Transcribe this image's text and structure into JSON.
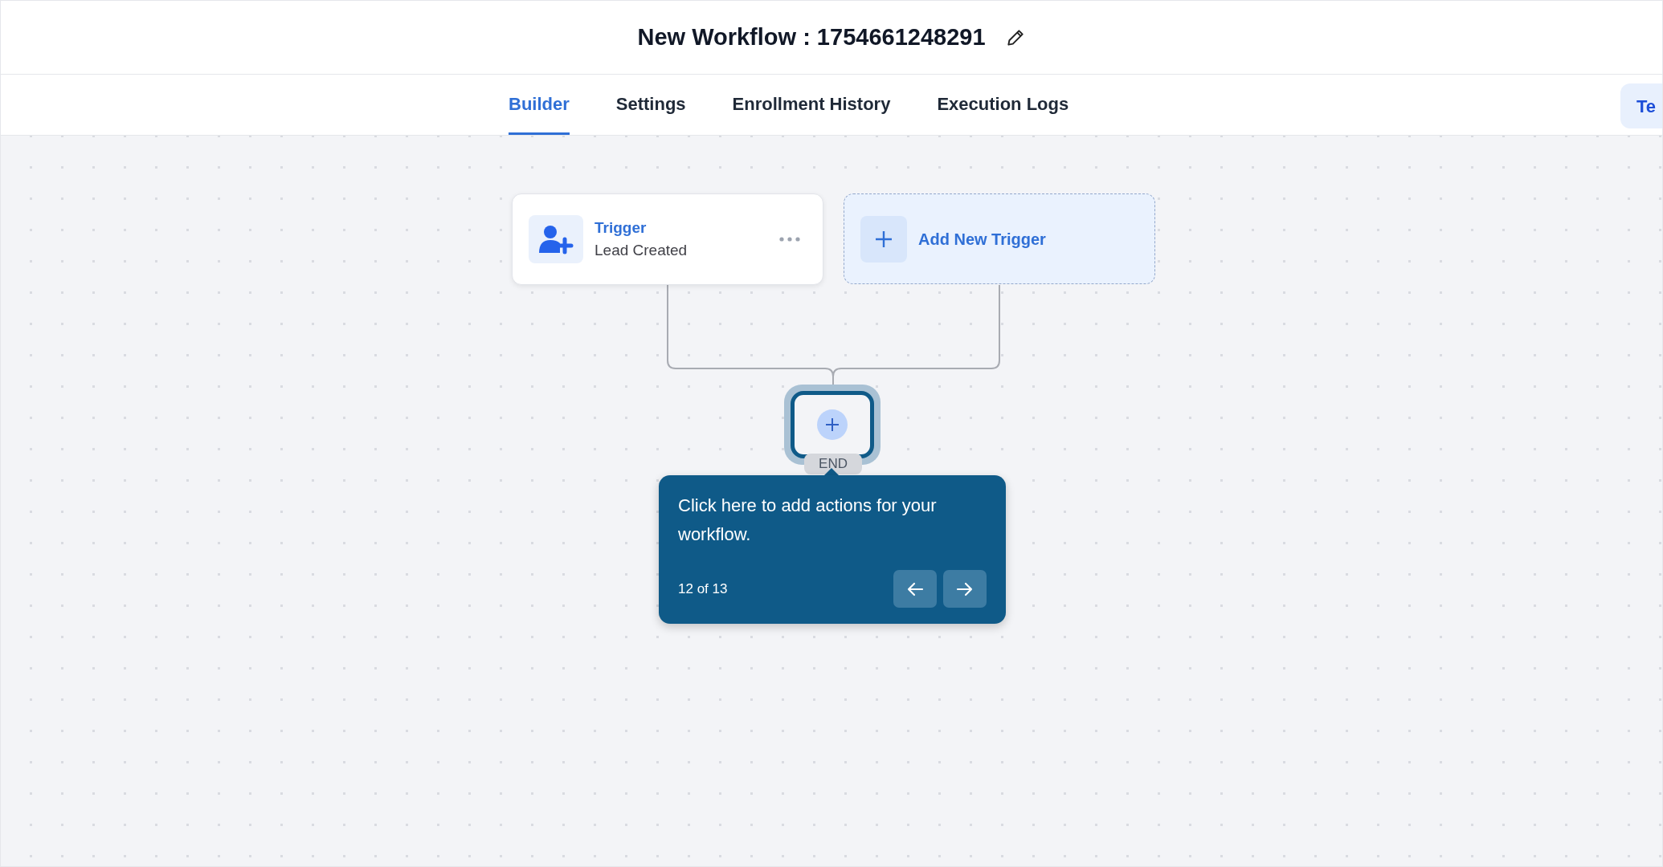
{
  "header": {
    "title": "New Workflow : 1754661248291"
  },
  "tabs": [
    {
      "label": "Builder",
      "selected": true
    },
    {
      "label": "Settings",
      "selected": false
    },
    {
      "label": "Enrollment History",
      "selected": false
    },
    {
      "label": "Execution Logs",
      "selected": false
    }
  ],
  "right_button": {
    "label": "Te"
  },
  "canvas": {
    "nodes": [
      {
        "kind": "trigger",
        "title": "Trigger",
        "subtitle": "Lead Created"
      },
      {
        "kind": "add",
        "label": "Add New Trigger"
      }
    ],
    "end_label": "END"
  },
  "tour_tooltip": {
    "text": "Click here to add actions for your workflow.",
    "progress": "12 of 13"
  }
}
